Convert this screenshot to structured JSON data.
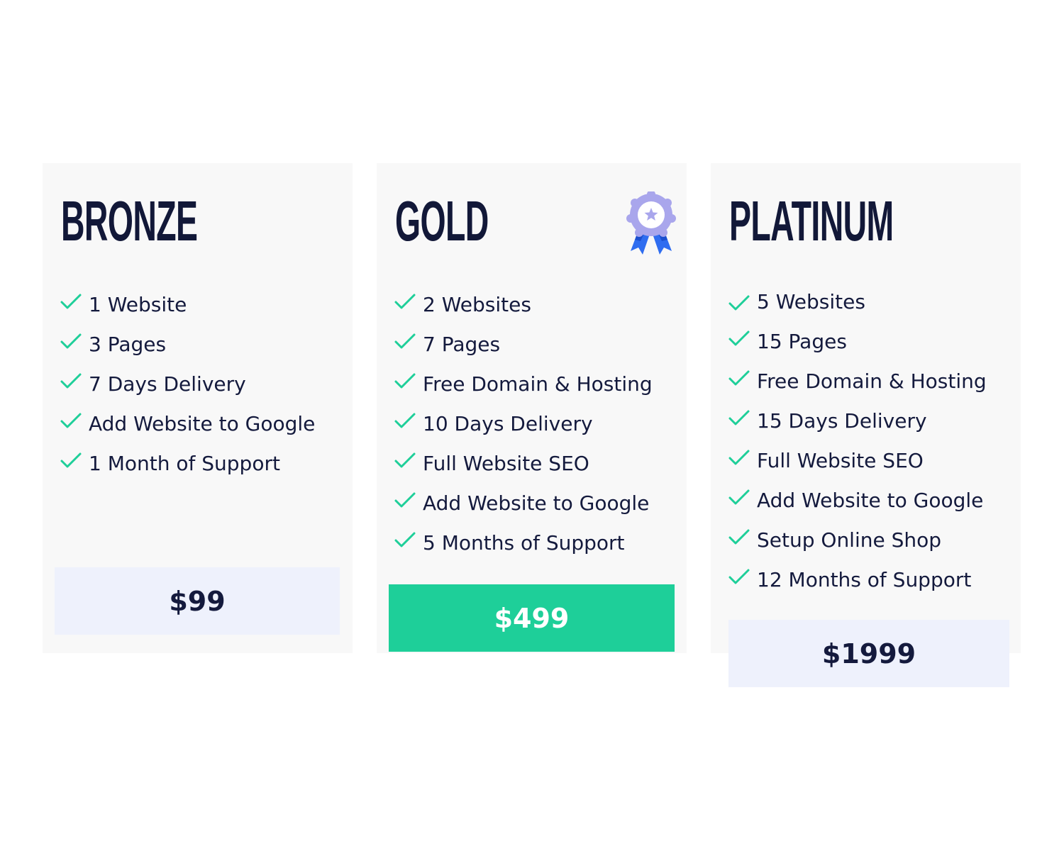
{
  "colors": {
    "check": "#1ecf99",
    "title": "#121838",
    "text": "#141a3d",
    "card_bg": "#f8f8f8",
    "price_bg": "#eef1fc",
    "highlight_price_bg": "#1ecf99",
    "highlight_price_text": "#ffffff"
  },
  "plans": [
    {
      "name": "BRONZE",
      "features": [
        "1 Website",
        "3 Pages",
        "7 Days Delivery",
        "Add Website to Google",
        "1 Month of Support"
      ],
      "price": "$99"
    },
    {
      "name": "GOLD",
      "badge_icon": "award-ribbon-icon",
      "features": [
        "2 Websites",
        "7 Pages",
        "Free Domain & Hosting",
        "10 Days Delivery",
        "Full Website SEO",
        "Add Website to Google",
        "5 Months of Support"
      ],
      "price": "$499"
    },
    {
      "name": "PLATINUM",
      "features": [
        "5 Websites",
        "15 Pages",
        "Free Domain & Hosting",
        "15 Days Delivery",
        "Full Website SEO",
        "Add Website to Google",
        "Setup Online Shop",
        "12 Months of Support"
      ],
      "price": "$1999"
    }
  ]
}
